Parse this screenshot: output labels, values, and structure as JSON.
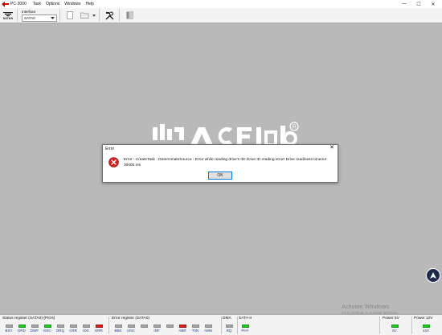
{
  "window": {
    "title": "PC-3000",
    "menu": [
      "Task",
      "Options",
      "Windows",
      "Help"
    ],
    "controls": {
      "minimize": "—",
      "maximize": "☐",
      "close": "✕"
    }
  },
  "toolbar": {
    "logo_text": "SATAN",
    "interface_label": "Interface",
    "interface_value": "SATA0"
  },
  "dialog": {
    "title": "Error",
    "close": "✕",
    "message": "Error : CreateTask - DeterminateSource - Error while reading drive's ID! Drive ID reading error! Drive readiness timeout 30000 ms",
    "ok_label": "OK"
  },
  "watermark": {
    "title": "Activate Windows",
    "subtitle": "Go to Settings to activate Windows."
  },
  "status": {
    "status_register": {
      "title": "Status register (SATA0)-[PIO4]",
      "leds": [
        {
          "label": "BSY",
          "state": "off"
        },
        {
          "label": "DRD",
          "state": "green"
        },
        {
          "label": "DWF",
          "state": "off"
        },
        {
          "label": "DSC",
          "state": "green"
        },
        {
          "label": "DRQ",
          "state": "off"
        },
        {
          "label": "CRR",
          "state": "off"
        },
        {
          "label": "IDX",
          "state": "off"
        },
        {
          "label": "ERR",
          "state": "red"
        }
      ]
    },
    "error_register": {
      "title": "Error register (SATA0)",
      "leds": [
        {
          "label": "BBK",
          "state": "off"
        },
        {
          "label": "UNC",
          "state": "off"
        },
        {
          "label": "",
          "state": "off"
        },
        {
          "label": "INF",
          "state": "off"
        },
        {
          "label": "",
          "state": "off"
        },
        {
          "label": "ABR",
          "state": "red"
        },
        {
          "label": "T0N",
          "state": "off"
        },
        {
          "label": "AMN",
          "state": "off"
        }
      ]
    },
    "dma": {
      "title": "DMA",
      "leds": [
        {
          "label": "RQ",
          "state": "off"
        }
      ]
    },
    "sata": {
      "title": "SATA-II",
      "leds": [
        {
          "label": "PHY",
          "state": "green"
        }
      ]
    },
    "power5": {
      "title": "Power 5V",
      "leds": [
        {
          "label": "5V",
          "state": "green"
        }
      ]
    },
    "power12": {
      "title": "Power 12V",
      "leds": [
        {
          "label": "12V",
          "state": "green"
        }
      ]
    }
  },
  "colors": {
    "led_green": "#22cc22",
    "led_red": "#e11a1a",
    "led_off": "#a5a5a5",
    "error_icon": "#d32020",
    "workspace": "#b9b9b9"
  }
}
